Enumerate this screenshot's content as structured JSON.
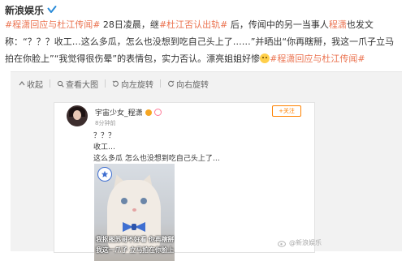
{
  "post": {
    "author": "新浪娱乐",
    "text_segments": [
      {
        "t": "#程潇回应与杜江传闻#",
        "cls": "link"
      },
      {
        "t": " 28日凌晨，继",
        "cls": ""
      },
      {
        "t": "#杜江否认出轨#",
        "cls": "link"
      },
      {
        "t": " 后，传闻中的另一当事人",
        "cls": ""
      },
      {
        "t": "程潇",
        "cls": "kw"
      },
      {
        "t": "也发文称：“？？？收工…这么多瓜，怎么也没想到吃自己头上了……”并晒出“你再瞎掰，我这一爪子立马拍在你脸上”“我觉得很伤晕”的表情包，实力否认。漂亮姐姐好惨",
        "cls": ""
      }
    ],
    "trailing_link": "#程潇回应与杜江传闻#"
  },
  "toolbar": {
    "collapse_label": "收起",
    "view_large_label": "查看大图",
    "rotate_left_label": "向左旋转",
    "rotate_right_label": "向右旋转"
  },
  "image": {
    "user_name": "宇宙少女_程潇",
    "time": "8分钟前",
    "follow_label": "+关注",
    "line1": "？？？",
    "line2": "收工…",
    "line3": "这么多瓜 怎么也没想到吃自己头上了…",
    "caption1": "我抠图苏哥不好看 你再瞎掰",
    "caption2": "我这一爪子 立马拍在你脸上",
    "watermark": "@新浪娱乐"
  }
}
